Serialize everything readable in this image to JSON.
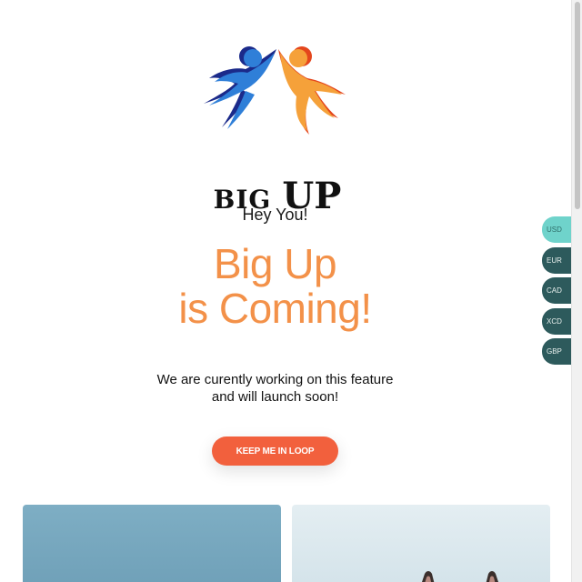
{
  "logo": {
    "word1": "BIG",
    "word2": "UP",
    "colors": {
      "left_figure": "#2e3fb0",
      "right_figure": "#f26a1b"
    }
  },
  "greeting": "Hey You!",
  "headline": [
    "Big Up",
    "is Coming!"
  ],
  "subtext": [
    "We are curently working on this feature",
    "and will launch soon!"
  ],
  "cta": {
    "label": "KEEP ME IN LOOP"
  },
  "currencies": [
    "USD",
    "EUR",
    "CAD",
    "XCD",
    "GBP"
  ],
  "selected_currency": "USD",
  "colors": {
    "accent": "#f39149",
    "button": "#f2603d",
    "currency_tab": "#2d5a5c",
    "currency_tab_active": "#6fd3cb"
  }
}
